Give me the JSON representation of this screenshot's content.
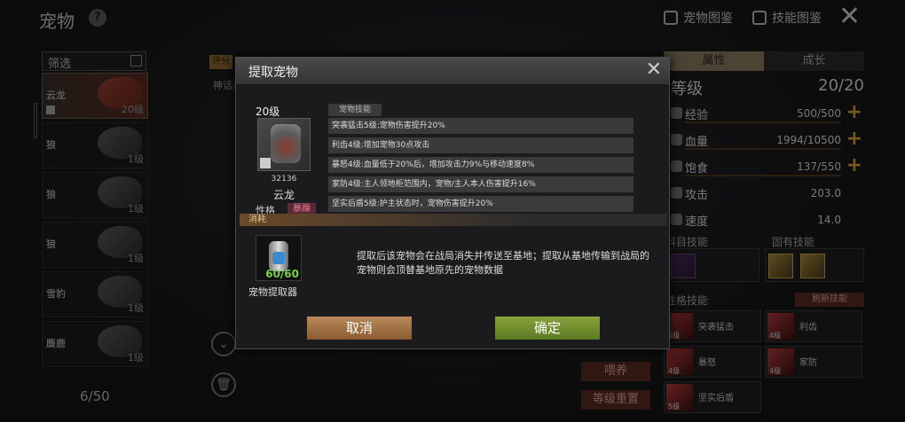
{
  "header": {
    "title": "宠物",
    "help_glyph": "?",
    "pet_atlas": "宠物图鉴",
    "skill_atlas": "技能图鉴",
    "close_glyph": "✕"
  },
  "list": {
    "filter": "筛选",
    "items": [
      {
        "name": "云龙",
        "level": "20级",
        "selected": true
      },
      {
        "name": "狼",
        "level": "1级"
      },
      {
        "name": "狼",
        "level": "1级"
      },
      {
        "name": "狼",
        "level": "1级"
      },
      {
        "name": "雪豹",
        "level": "1级"
      },
      {
        "name": "麋鹿",
        "level": "1级"
      }
    ],
    "count": "6/50"
  },
  "behind": {
    "rating_tag": "评分",
    "hint": "神话品"
  },
  "right": {
    "tabs": [
      "属性",
      "成长"
    ],
    "level_label": "等级",
    "level_value": "20/20",
    "stats": [
      {
        "name": "经验",
        "value": "500/500",
        "plus": true
      },
      {
        "name": "血量",
        "value": "1994/10500",
        "plus": true
      },
      {
        "name": "饱食",
        "value": "137/550",
        "plus": true
      },
      {
        "name": "攻击",
        "value": "203.0",
        "plus": false
      },
      {
        "name": "速度",
        "value": "14.0",
        "plus": false
      }
    ],
    "subject_skills": "科目技能",
    "innate_skills": "固有技能",
    "trait_skills": "性格技能",
    "refresh": "刷新技能",
    "personality": [
      {
        "name": "突袭猛击",
        "lv": "5级"
      },
      {
        "name": "利齿",
        "lv": "4级"
      },
      {
        "name": "暴怒",
        "lv": "4级"
      },
      {
        "name": "家防",
        "lv": "4级"
      },
      {
        "name": "坚实后盾",
        "lv": "5级"
      }
    ],
    "btn_feed": "喂养",
    "btn_reset": "等级重置"
  },
  "modal": {
    "title": "提取宠物",
    "close_glyph": "✕",
    "pet": {
      "level": "20级",
      "id": "32136",
      "name": "云龙",
      "trait_label": "性格",
      "trait_value": "暴躁"
    },
    "skills_header": "宠物技能",
    "skills": [
      "突袭猛击5级:宠物伤害提升20%",
      "利齿4级:增加宠物30点攻击",
      "暴怒4级:血量低于20%后，增加攻击力9%与移动速度8%",
      "家防4级:主人领地柜范围内，宠物/主人本人伤害提升16%",
      "坚实后盾5级:护主状态时，宠物伤害提升20%"
    ],
    "consume_header": "消耗",
    "item": {
      "name": "宠物提取器",
      "count": "60/60"
    },
    "notice": "提取后该宠物会在战局消失并传送至基地；提取从基地传输到战局的宠物则会顶替基地原先的宠物数据",
    "cancel": "取消",
    "confirm": "确定"
  }
}
